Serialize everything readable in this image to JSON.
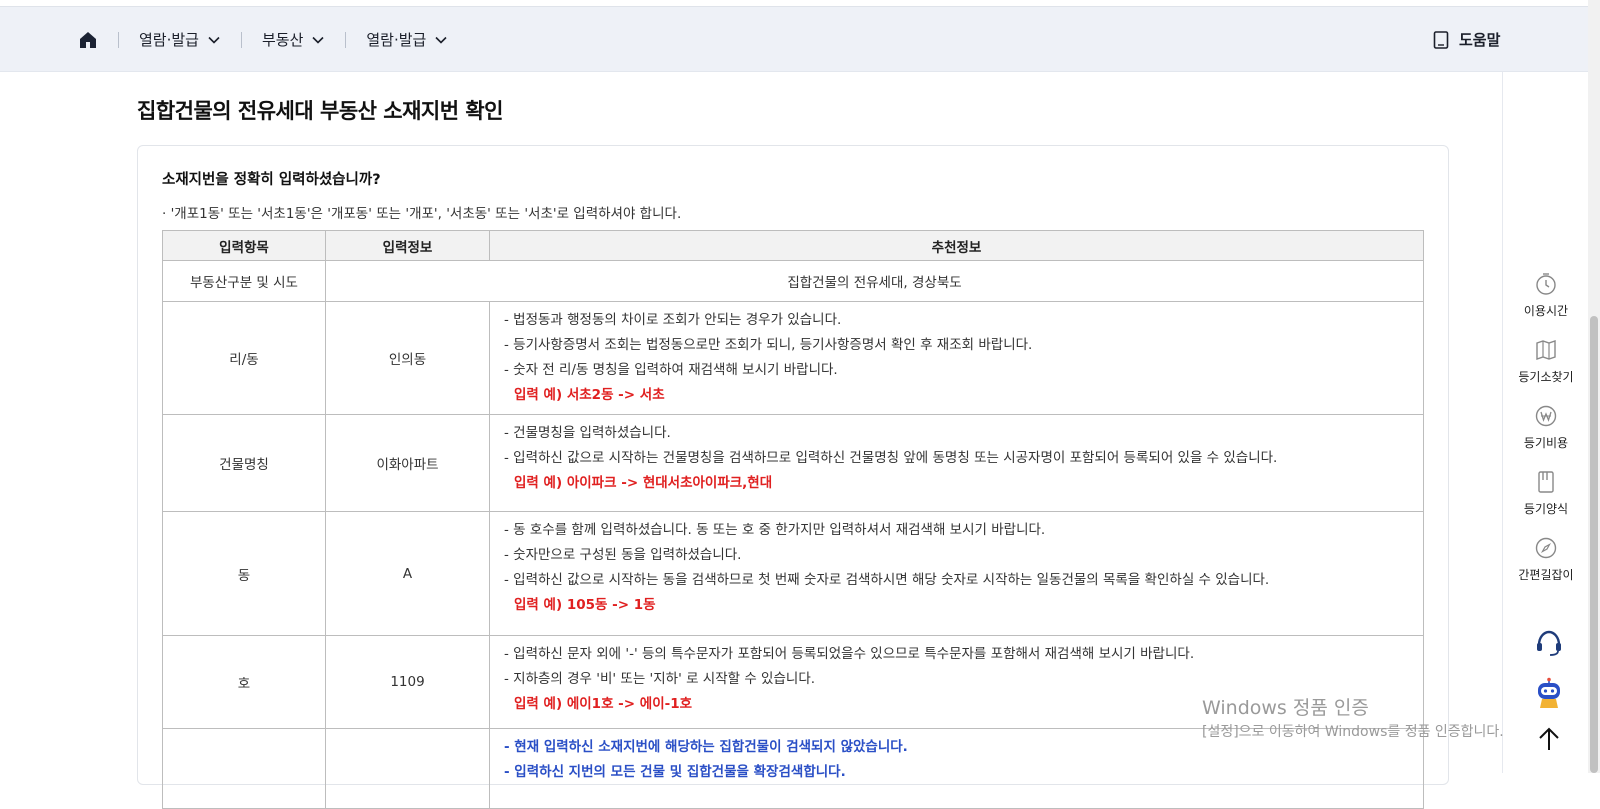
{
  "nav": {
    "items": [
      {
        "label": "열람·발급"
      },
      {
        "label": "부동산"
      },
      {
        "label": "열람·발급"
      }
    ],
    "help_label": "도움말"
  },
  "side_rail": {
    "items": [
      {
        "label": "이용시간",
        "icon": "clock-icon"
      },
      {
        "label": "등기소찾기",
        "icon": "map-icon"
      },
      {
        "label": "등기비용",
        "icon": "won-coin-icon"
      },
      {
        "label": "등기양식",
        "icon": "document-icon"
      },
      {
        "label": "간편길잡이",
        "icon": "compass-icon"
      }
    ]
  },
  "page": {
    "title": "집합건물의 전유세대 부동산 소재지번 확인",
    "question": "소재지번을 정확히 입력하셨습니까?",
    "note": "· '개포1동' 또는 '서초1동'은 '개포동' 또는 '개포', '서초동' 또는 '서초'로 입력하셔야 합니다."
  },
  "table": {
    "headers": [
      "입력항목",
      "입력정보",
      "추천정보"
    ],
    "row_type": {
      "label": "부동산구분 및 시도",
      "merged_value": "집합건물의 전유세대, 경상북도"
    },
    "rows": [
      {
        "label": "리/동",
        "value": "인의동",
        "lines": [
          "- 법정동과 행정동의 차이로 조회가 안되는 경우가 있습니다.",
          "- 등기사항증명서 조회는 법정동으로만 조회가 되니, 등기사항증명서 확인 후 재조회 바랍니다.",
          "- 숫자 전 리/동 명칭을 입력하여 재검색해 보시기 바랍니다."
        ],
        "example": "입력 예) 서초2동 -> 서초"
      },
      {
        "label": "건물명칭",
        "value": "이화아파트",
        "lines": [
          "- 건물명칭을 입력하셨습니다.",
          "- 입력하신 값으로 시작하는 건물명칭을 검색하므로 입력하신 건물명칭 앞에 동명칭 또는 시공자명이 포함되어 등록되어 있을 수 있습니다."
        ],
        "example": "입력 예) 아이파크 -> 현대서초아이파크,현대"
      },
      {
        "label": "동",
        "value": "A",
        "lines": [
          "- 동 호수를 함께 입력하셨습니다. 동 또는 호 중 한가지만 입력하셔서 재검색해 보시기 바랍니다.",
          "- 숫자만으로 구성된 동을 입력하셨습니다.",
          "- 입력하신 값으로 시작하는 동을 검색하므로 첫 번째 숫자로 검색하시면 해당 숫자로 시작하는 일동건물의 목록을 확인하실 수 있습니다."
        ],
        "example": "입력 예) 105동 -> 1동"
      },
      {
        "label": "호",
        "value": "1109",
        "lines": [
          "- 입력하신 문자 외에 '-' 등의 특수문자가 포함되어 등록되었을수 있으므로 특수문자를 포함해서 재검색해 보시기 바랍니다.",
          "- 지하층의 경우 '비' 또는 '지하' 로 시작할 수 있습니다."
        ],
        "example": "입력 예) 에이1호 -> 에이-1호"
      }
    ],
    "final_notes": [
      "- 현재 입력하신 소재지번에 해당하는 집합건물이 검색되지 않았습니다.",
      "- 입력하신 지번의 모든 건물 및 집합건물을 확장검색합니다."
    ]
  },
  "watermark": {
    "line1": "Windows 정품 인증",
    "line2": "[설정]으로 이동하여 Windows를 정품 인증합니다."
  },
  "colors": {
    "nav_bg": "#eef1f7",
    "example_red": "#e02020",
    "notice_blue": "#2a4fc6"
  }
}
